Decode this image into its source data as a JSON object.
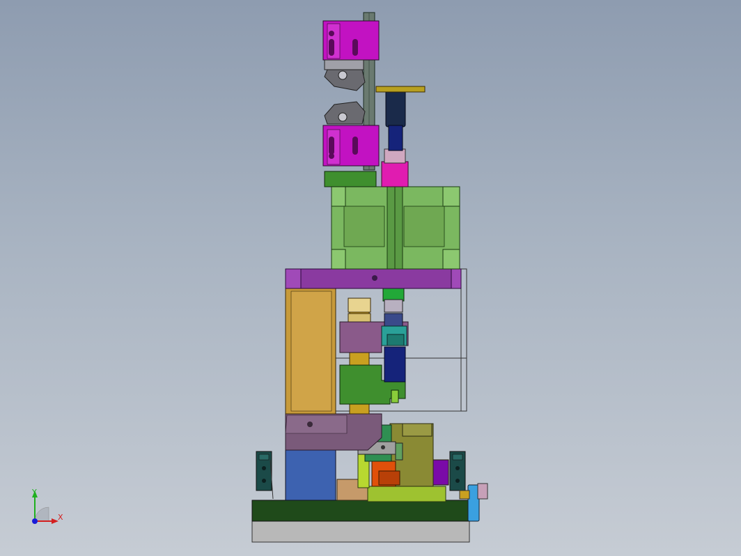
{
  "viewport": {
    "background_top": "#8e9cb0",
    "background_bottom": "#c6ccd4"
  },
  "triad": {
    "x_label": "X",
    "y_label": "Y",
    "x_color": "#d42020",
    "y_color": "#1fb01f",
    "z_color": "#1a1ad8"
  },
  "part_colors": {
    "magenta": "#c212c2",
    "green_motor": "#7bb860",
    "purple_plate": "#8a3aa0",
    "gold_column": "#c79a3a",
    "blue_block": "#3d62b0",
    "dark_green_base": "#1f4a1a",
    "grey_base": "#b8b8b8",
    "pink_coupler": "#e01cb0",
    "teal": "#2aa098",
    "navy": "#15237a",
    "orange": "#e0500a",
    "olive": "#9a9a3a",
    "lime": "#9ec230",
    "tan": "#c69a6a",
    "light_blue": "#3aa0e0"
  }
}
